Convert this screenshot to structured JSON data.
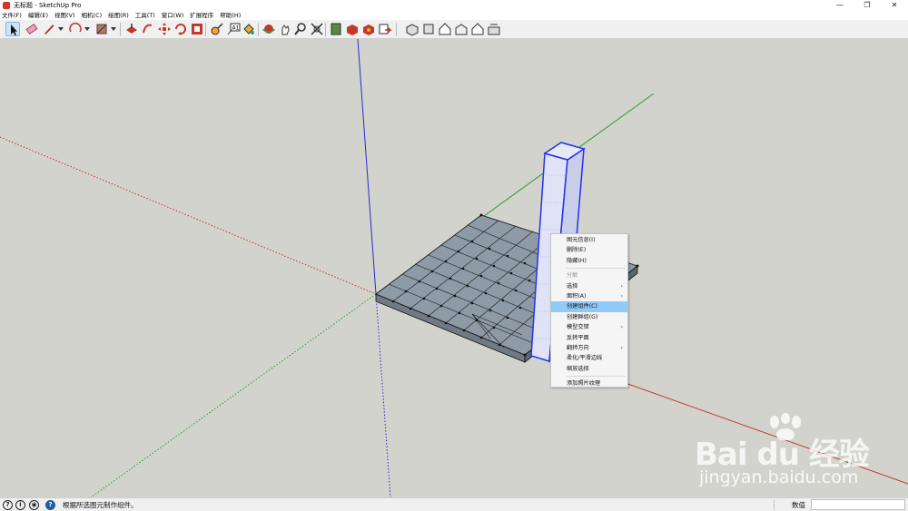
{
  "window": {
    "title": "无标题 - SketchUp Pro",
    "controls": [
      "—",
      "❐",
      "✕"
    ]
  },
  "menubar": {
    "items": [
      "文件(F)",
      "编辑(E)",
      "视图(V)",
      "相机(C)",
      "绘图(R)",
      "工具(T)",
      "窗口(W)",
      "扩展程序",
      "帮助(H)"
    ]
  },
  "context_menu": {
    "items": [
      {
        "label": "图元信息(I)"
      },
      {
        "label": "删除(E)"
      },
      {
        "label": "隐藏(H)"
      },
      {
        "label": "分解"
      },
      {
        "label": "选择"
      },
      {
        "label": "面积(A)"
      },
      {
        "label": "创建组件(C)"
      },
      {
        "label": "创建群组(G)"
      },
      {
        "label": "模型交错"
      },
      {
        "label": "反转平面"
      },
      {
        "label": "翻转方向"
      },
      {
        "label": "柔化/平滑边线"
      },
      {
        "label": "缩放选择"
      },
      {
        "label": "添加照片纹理"
      }
    ],
    "highlighted": "创建组件(C)",
    "disabled": "分解"
  },
  "statusbar": {
    "message": "根据所选图元制作组件。",
    "value_label": "数值",
    "value": ""
  },
  "watermark": {
    "logo": "Bai du 经验",
    "url": "jingyan.baidu.com"
  },
  "colors": {
    "viewport_bg": "#d3d3cd",
    "axis_red": "#c0392b",
    "axis_green": "#2e9a2e",
    "axis_blue": "#2a2ad0",
    "face": "#8e9aa6",
    "selection": "#2233ee",
    "menu_highlight": "#91c9f7"
  }
}
